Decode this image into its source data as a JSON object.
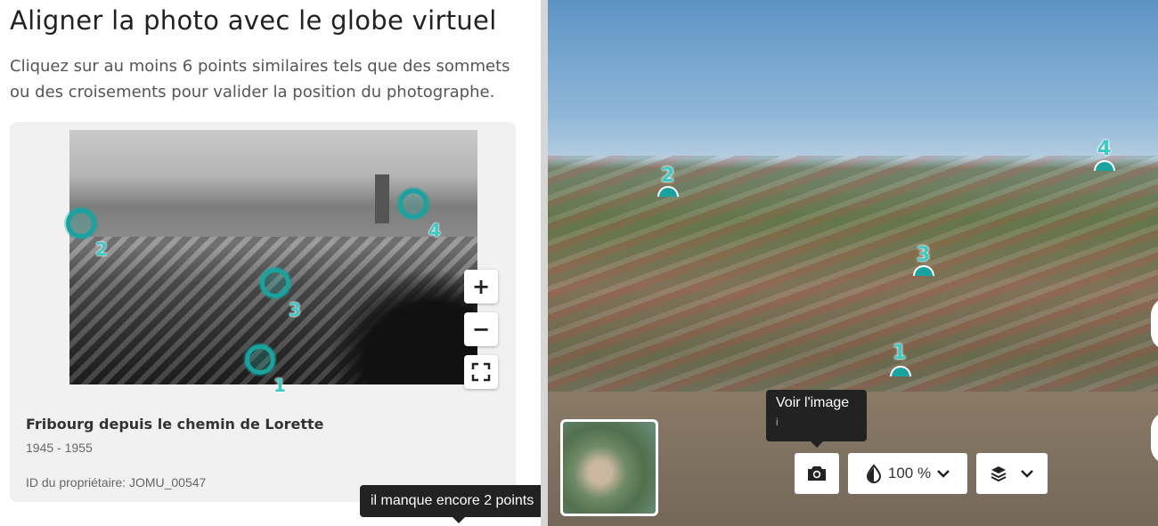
{
  "header": {
    "title": "Aligner la photo avec le globe virtuel",
    "instructions": "Cliquez sur au moins 6 points similaires tels que des sommets ou des croisements pour valider la position du photographe."
  },
  "photo": {
    "points": [
      "1",
      "2",
      "3",
      "4"
    ],
    "zoom_in": "+",
    "zoom_out": "−"
  },
  "caption": {
    "title": "Fribourg depuis le chemin de Lorette",
    "date": "1945 - 1955",
    "owner_id": "ID du propriétaire: JOMU_00547"
  },
  "status_tooltip": "il manque encore 2 points",
  "globe": {
    "points": [
      "1",
      "2",
      "3",
      "4"
    ],
    "tooltip_title": "Voir l'image",
    "tooltip_shortcut": "i",
    "opacity_value": "100 %"
  },
  "colors": {
    "marker": "#1aa39e",
    "marker_label": "#3fc9c3",
    "tooltip_bg": "#222222"
  },
  "icons": [
    "plus-icon",
    "minus-icon",
    "fullscreen-icon",
    "camera-icon",
    "opacity-drop-icon",
    "chevron-down-icon",
    "layers-icon"
  ]
}
